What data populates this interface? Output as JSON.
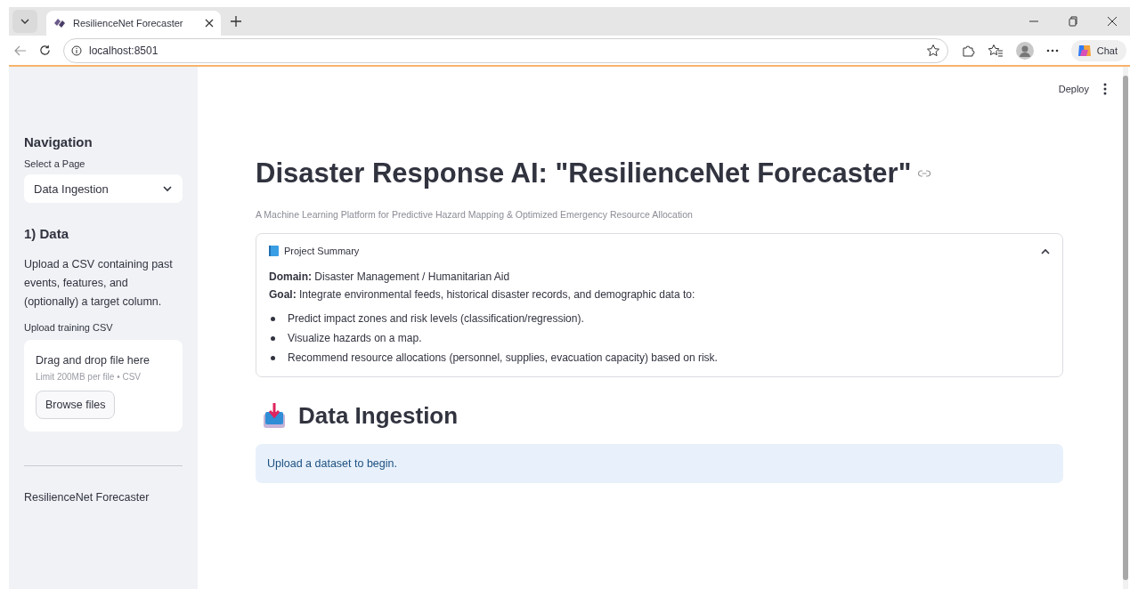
{
  "browser": {
    "tab_title": "ResilienceNet Forecaster",
    "url": "localhost:8501",
    "chat_label": "Chat"
  },
  "app_header": {
    "deploy_label": "Deploy"
  },
  "sidebar": {
    "heading": "Navigation",
    "select_label": "Select a Page",
    "select_value": "Data Ingestion",
    "section_heading": "1) Data",
    "description": "Upload a CSV containing past events, features, and (optionally) a target column.",
    "upload_label": "Upload training CSV",
    "dropzone_title": "Drag and drop file here",
    "dropzone_hint": "Limit 200MB per file • CSV",
    "browse_button": "Browse files",
    "footer": "ResilienceNet Forecaster"
  },
  "main": {
    "title": "Disaster Response AI: \"ResilienceNet Forecaster\"",
    "caption": "A Machine Learning Platform for Predictive Hazard Mapping & Optimized Emergency Resource Allocation",
    "expander": {
      "title": "Project Summary",
      "expanded": true,
      "lines": [
        "**Domain:** Disaster Management / Humanitarian Aid",
        "**Goal:** Integrate environmental feeds, historical disaster records, and demographic data to:"
      ],
      "bullets": [
        "Predict impact zones and risk levels (classification/regression).",
        "Visualize hazards on a map.",
        "Recommend resource allocations (personnel, supplies, evacuation capacity) based on risk."
      ]
    },
    "section_heading": "Data Ingestion",
    "info": "Upload a dataset to begin."
  }
}
